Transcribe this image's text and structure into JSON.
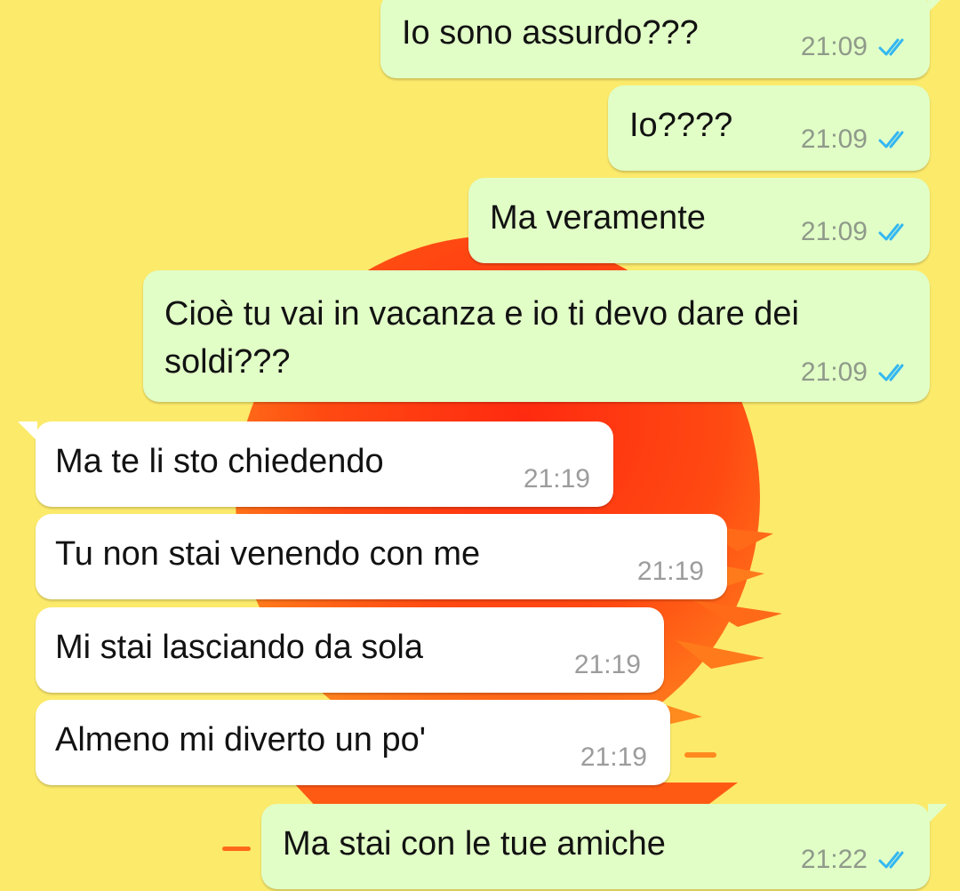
{
  "colors": {
    "wallpaper_yellow": "#fcea6b",
    "sun_orange": "#ff5a14",
    "outgoing_bubble": "#e1fec6",
    "incoming_bubble": "#ffffff",
    "read_ticks": "#34b7f1"
  },
  "messages": [
    {
      "direction": "outgoing",
      "text": "Io sono assurdo???",
      "time": "21:09",
      "status_icon": "double-check-read-icon"
    },
    {
      "direction": "outgoing",
      "text": "Io????",
      "time": "21:09",
      "status_icon": "double-check-read-icon"
    },
    {
      "direction": "outgoing",
      "text": "Ma veramente",
      "time": "21:09",
      "status_icon": "double-check-read-icon"
    },
    {
      "direction": "outgoing",
      "text": "Cioè tu vai in vacanza e io ti devo dare dei soldi???",
      "time": "21:09",
      "status_icon": "double-check-read-icon"
    },
    {
      "direction": "incoming",
      "text": "Ma te li sto chiedendo",
      "time": "21:19"
    },
    {
      "direction": "incoming",
      "text": "Tu non stai venendo con me",
      "time": "21:19"
    },
    {
      "direction": "incoming",
      "text": "Mi stai lasciando da sola",
      "time": "21:19"
    },
    {
      "direction": "incoming",
      "text": "Almeno mi diverto un po'",
      "time": "21:19"
    },
    {
      "direction": "outgoing",
      "text": "Ma stai con le tue amiche",
      "time": "21:22",
      "status_icon": "double-check-read-icon"
    }
  ]
}
